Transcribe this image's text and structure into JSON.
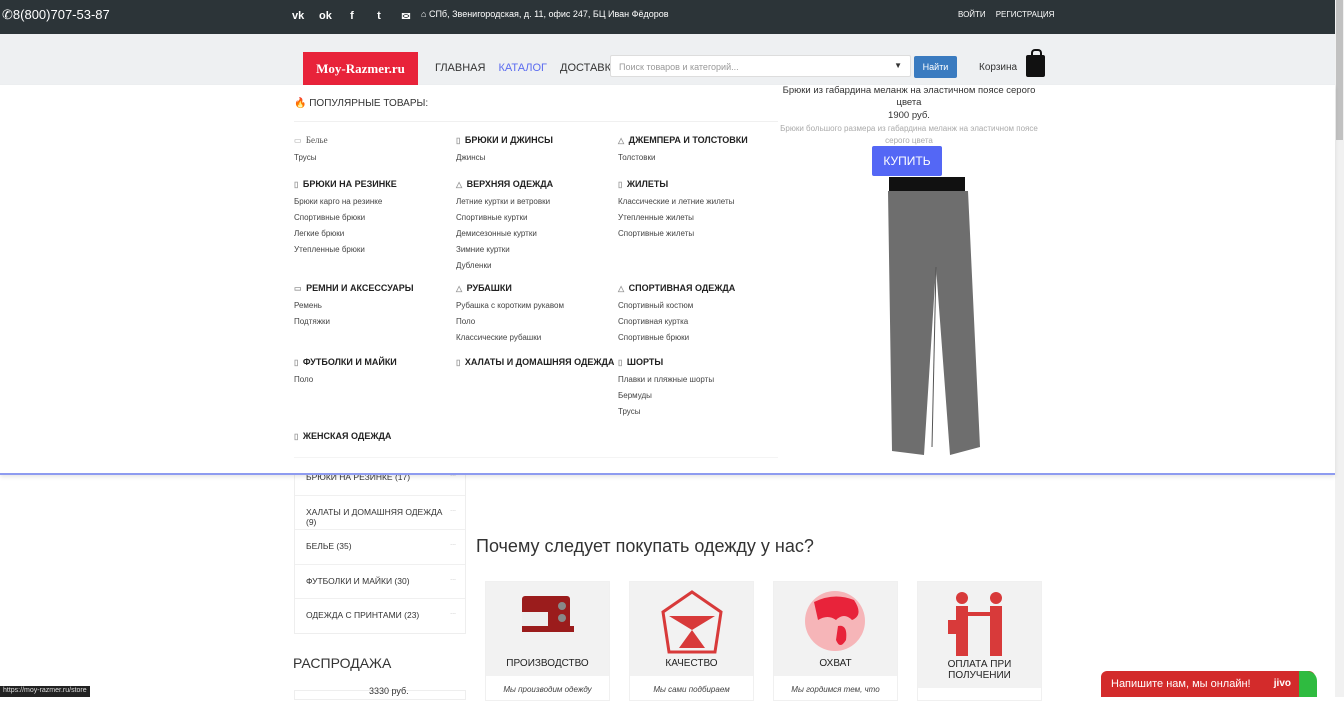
{
  "topbar": {
    "phone": "8(800)707-53-87",
    "social": [
      "vk",
      "ok",
      "facebook",
      "twitter",
      "email"
    ],
    "address": "СПб, Звенигородская, д. 11, офис 247, БЦ Иван Фёдоров",
    "login": "ВОЙТИ",
    "register": "РЕГИСТРАЦИЯ"
  },
  "header": {
    "logo": "Moy-Razmer.ru",
    "nav": [
      "ГЛАВНАЯ",
      "КАТАЛОГ",
      "ДОСТАВКА"
    ],
    "search_placeholder": "Поиск товаров и категорий...",
    "search_button": "Найти",
    "cart": "Корзина"
  },
  "mega": {
    "popular": "ПОПУЛЯРНЫЕ ТОВАРЫ:",
    "categories": [
      {
        "title": "Белье",
        "items": [
          "Трусы"
        ]
      },
      {
        "title": "БРЮКИ И ДЖИНСЫ",
        "items": [
          "Джинсы"
        ]
      },
      {
        "title": "ДЖЕМПЕРА И ТОЛСТОВКИ",
        "items": [
          "Толстовки"
        ]
      },
      {
        "title": "БРЮКИ НА РЕЗИНКЕ",
        "items": [
          "Брюки карго на резинке",
          "Спортивные брюки",
          "Легкие брюки",
          "Утепленные брюки"
        ]
      },
      {
        "title": "ВЕРХНЯЯ ОДЕЖДА",
        "items": [
          "Летние куртки и ветровки",
          "Спортивные куртки",
          "Демисезонные куртки",
          "Зимние куртки",
          "Дубленки"
        ]
      },
      {
        "title": "ЖИЛЕТЫ",
        "items": [
          "Классические и летние жилеты",
          "Утепленные жилеты",
          "Спортивные жилеты"
        ]
      },
      {
        "title": "РЕМНИ И АКСЕССУАРЫ",
        "items": [
          "Ремень",
          "Подтяжки"
        ]
      },
      {
        "title": "РУБАШКИ",
        "items": [
          "Рубашка с коротким рукавом",
          "Поло",
          "Классические рубашки"
        ]
      },
      {
        "title": "СПОРТИВНАЯ ОДЕЖДА",
        "items": [
          "Спортивный костюм",
          "Спортивная куртка",
          "Спортивные брюки"
        ]
      },
      {
        "title": "ФУТБОЛКИ И МАЙКИ",
        "items": [
          "Поло"
        ]
      },
      {
        "title": "ХАЛАТЫ И ДОМАШНЯЯ ОДЕЖДА",
        "items": []
      },
      {
        "title": "ШОРТЫ",
        "items": [
          "Плавки и пляжные шорты",
          "Бермуды",
          "Трусы"
        ]
      },
      {
        "title": "ЖЕНСКАЯ ОДЕЖДА",
        "items": []
      }
    ],
    "promo": {
      "title": "Брюки из габардина меланж на эластичном поясе серого цвета",
      "price": "1900 руб.",
      "desc": "Брюки большого размера из габардина меланж на эластичном поясе серого цвета",
      "buy": "КУПИТЬ"
    }
  },
  "sidebar": {
    "items": [
      "БРЮКИ НА РЕЗИНКЕ (17)",
      "ХАЛАТЫ И ДОМАШНЯЯ ОДЕЖДА (9)",
      "БЕЛЬЕ (35)",
      "ФУТБОЛКИ И МАЙКИ (30)",
      "ОДЕЖДА С ПРИНТАМИ (23)"
    ],
    "sale_title": "РАСПРОДАЖА",
    "sale_price": "3330 руб."
  },
  "why": {
    "title": "Почему следует покупать одежду у нас?",
    "cards": [
      {
        "label": "ПРОИЗВОДСТВО",
        "desc": "Мы производим одежду"
      },
      {
        "label": "КАЧЕСТВО",
        "desc": "Мы сами подбираем"
      },
      {
        "label": "ОХВАТ",
        "desc": "Мы гордимся тем, что"
      },
      {
        "label": "ОПЛАТА ПРИ ПОЛУЧЕНИИ",
        "desc": ""
      }
    ]
  },
  "chat": {
    "text": "Напишите нам, мы онлайн!",
    "brand": "jivo"
  },
  "status_url": "https://moy-razmer.ru/store",
  "colors": {
    "topbar": "#2c3438",
    "logo": "#e8233a",
    "accent": "#5467f5",
    "icons": "#d83a3a"
  }
}
